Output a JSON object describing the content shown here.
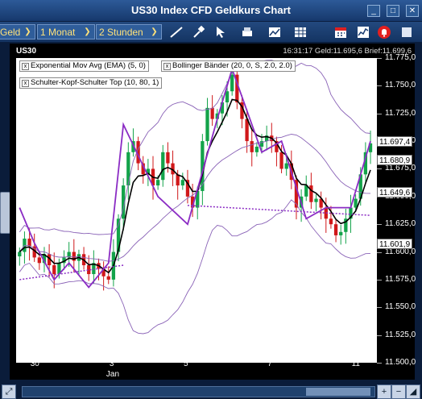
{
  "window": {
    "title": "US30 Index CFD Geldkurs Chart"
  },
  "toolbar": {
    "price_type": "Geld",
    "period": "1 Monat",
    "interval": "2 Stunden",
    "icons": [
      "draw-line-icon",
      "pin-icon",
      "cursor-icon",
      "print-icon",
      "export-chart-icon",
      "grid-table-icon",
      "calendar-icon",
      "indicators-icon",
      "alarm-bell-icon"
    ]
  },
  "chart": {
    "symbol": "US30",
    "header_info": "16:31:17   Geld:11.695,6   Brief:11.699,6",
    "legends": {
      "ema": "Exponential Mov Avg (EMA) (5, 0)",
      "bollinger": "Bollinger Bänder (20, 0, S, 2.0, 2.0)",
      "pattern": "Schulter-Kopf-Schulter Top (10, 80, 1)"
    },
    "price_boxes": [
      "11.697,4",
      "11.680,9",
      "11.649,6",
      "11.601,9"
    ],
    "colors": {
      "bull": "#13a34a",
      "bear": "#d0181a",
      "ema": "#000000",
      "bollinger": "#8a63b7",
      "pattern": "#8b2cc4"
    }
  },
  "chart_data": {
    "type": "candlestick",
    "y_tick_labels": [
      "11.775,0",
      "11.750,0",
      "11.725,0",
      "11.700,0",
      "11.675,0",
      "11.650,0",
      "11.625,0",
      "11.600,0",
      "11.575,0",
      "11.550,0",
      "11.525,0",
      "11.500,0"
    ],
    "ylim": [
      11500,
      11775
    ],
    "x_ticks": [
      {
        "label": "30",
        "bar": 3
      },
      {
        "label": "3",
        "bar": 19
      },
      {
        "label": "5",
        "bar": 34
      },
      {
        "label": "7",
        "bar": 51
      },
      {
        "label": "11",
        "bar": 68
      }
    ],
    "x_sublabels": [
      {
        "label": "Jan",
        "bar": 19
      }
    ],
    "closes": [
      11600,
      11612,
      11605,
      11595,
      11590,
      11598,
      11588,
      11580,
      11590,
      11595,
      11600,
      11592,
      11598,
      11588,
      11580,
      11590,
      11585,
      11578,
      11575,
      11600,
      11630,
      11660,
      11690,
      11700,
      11680,
      11670,
      11675,
      11660,
      11665,
      11690,
      11680,
      11670,
      11660,
      11665,
      11650,
      11640,
      11655,
      11700,
      11730,
      11720,
      11725,
      11735,
      11745,
      11760,
      11735,
      11720,
      11700,
      11690,
      11695,
      11700,
      11705,
      11700,
      11690,
      11675,
      11680,
      11665,
      11640,
      11650,
      11660,
      11645,
      11648,
      11640,
      11630,
      11625,
      11615,
      11618,
      11630,
      11640,
      11648,
      11670,
      11690,
      11698
    ],
    "ema_period": 5,
    "bollinger_period": 20,
    "bollinger_std": 2.0,
    "pattern_line": [
      [
        0,
        11640
      ],
      [
        3,
        11608
      ],
      [
        7,
        11575
      ],
      [
        10,
        11590
      ],
      [
        14,
        11568
      ],
      [
        18,
        11590
      ],
      [
        21,
        11715
      ],
      [
        28,
        11650
      ],
      [
        34,
        11625
      ],
      [
        40,
        11720
      ],
      [
        43,
        11765
      ],
      [
        49,
        11690
      ],
      [
        53,
        11700
      ],
      [
        58,
        11630
      ],
      [
        62,
        11640
      ],
      [
        67,
        11640
      ],
      [
        71,
        11700
      ]
    ],
    "neckline_segments": [
      [
        [
          0,
          11575
        ],
        [
          21,
          11588
        ]
      ],
      [
        [
          34,
          11642
        ],
        [
          71,
          11633
        ]
      ]
    ],
    "bar_count": 72
  }
}
